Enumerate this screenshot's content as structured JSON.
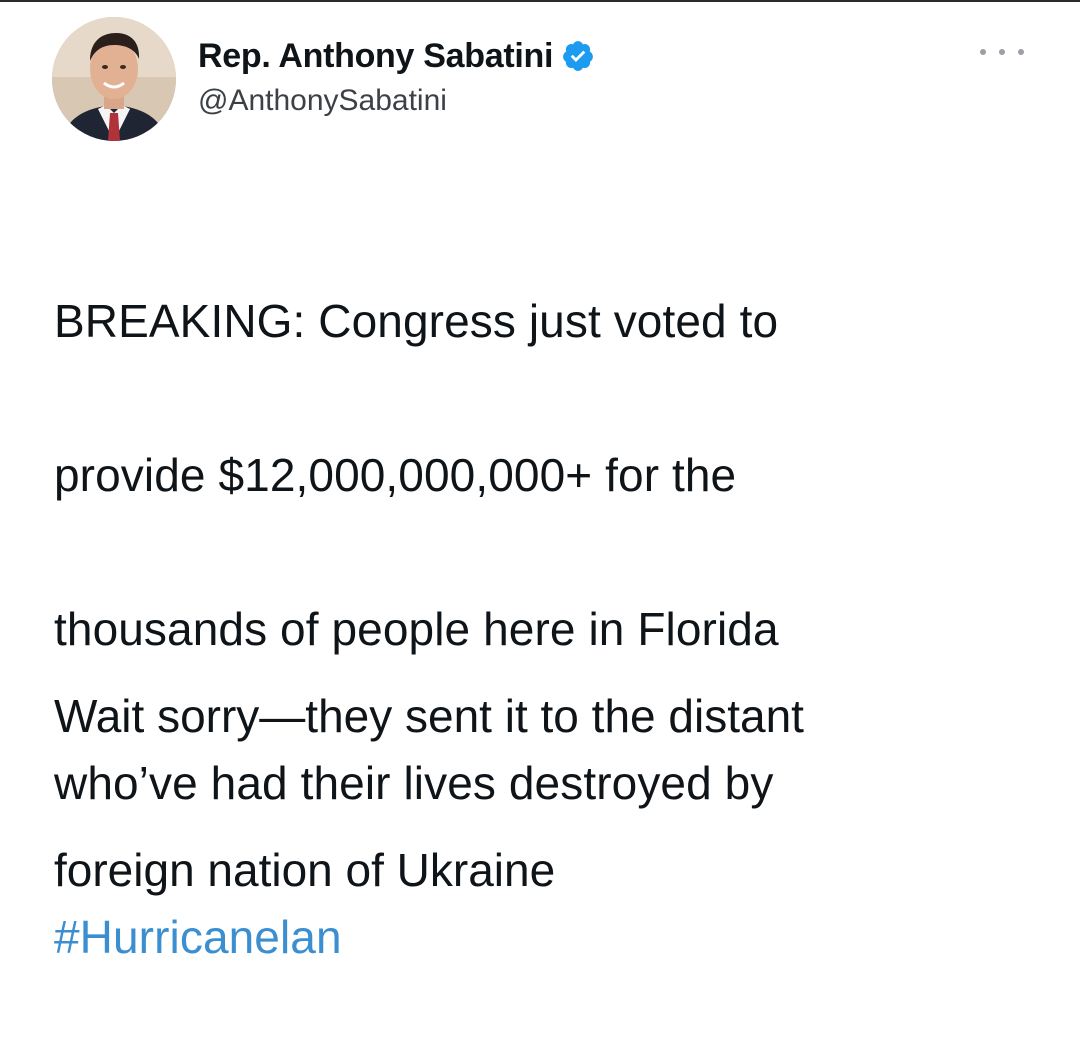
{
  "tweet": {
    "author": {
      "display_name": "Rep. Anthony Sabatini",
      "handle": "@AnthonySabatini",
      "verified": true,
      "avatar_icon": "profile-photo"
    },
    "more_icon": "ellipsis-icon",
    "body_line_1": "BREAKING: Congress just voted to",
    "body_line_2": "provide $12,000,000,000+ for the",
    "body_line_3": "thousands of people here in Florida",
    "body_line_4": "who’ve had their lives destroyed by",
    "hashtag": "#Hurricanelan",
    "para2_line_1": "Wait sorry—they sent it to the distant",
    "para2_line_2": "foreign nation of Ukraine"
  },
  "colors": {
    "text": "#0f1419",
    "handle": "#3c4147",
    "link": "#3b8fd0",
    "verified_badge": "#1d9bf0"
  }
}
